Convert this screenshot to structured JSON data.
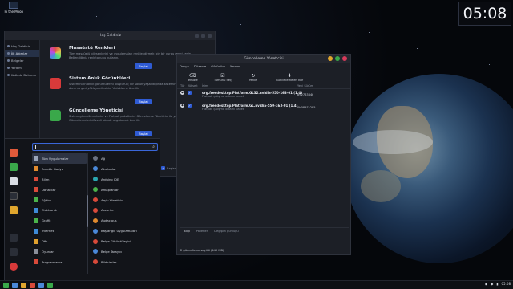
{
  "desktop": {
    "icon_label": "To the Moon"
  },
  "clock": {
    "time": "05:08"
  },
  "welcome": {
    "title": "Hoş Geldiniz",
    "sidebar": [
      {
        "label": "Hoş Geldiniz"
      },
      {
        "label": "İlk Adımlar"
      },
      {
        "label": "Belgeler"
      },
      {
        "label": "Yardım"
      },
      {
        "label": "Katkıda Bulunun"
      }
    ],
    "sections": [
      {
        "heading": "Masaüstü Renkleri",
        "text": "Tüm masaüstü bileşenlerini ve uygulamaları renklendirmek için bir vurgu rengi seçin. Beğendiğiniz renk tonunu kullanın.",
        "button": "Başlat"
      },
      {
        "heading": "Sistem Anlık Görüntüleri",
        "text": "Sisteminizin anlık görüntülerini oluşturun; bir sorun yaşandığında sisteminizi önceki bir duruma geri yükleyebilirsiniz. Yedekleme önerilir.",
        "button": "Başlat"
      },
      {
        "heading": "Güncelleme Yöneticisi",
        "text": "Sistem güncellemelerini ve Flatpak paketlerini Güncelleme Yöneticisi ile yönetin. Güncellemeleri düzenli olarak uygulamak önerilir.",
        "button": "Başlat"
      }
    ],
    "checkbox_label": "Başlan..."
  },
  "updates": {
    "title": "Güncelleme Yöneticisi",
    "menu": [
      "Dosya",
      "Düzenle",
      "Görünüm",
      "Yardım"
    ],
    "toolbar": [
      {
        "label": "Temizle",
        "icon": "clear-icon"
      },
      {
        "label": "Tümünü Seç",
        "icon": "select-all-icon"
      },
      {
        "label": "Yenile",
        "icon": "refresh-icon"
      },
      {
        "label": "Güncellemeleri Kur",
        "icon": "install-icon"
      }
    ],
    "columns": {
      "type": "Tür",
      "upgrade": "Yükselt",
      "name": "İsim",
      "new_version": "Yeni Sürüm"
    },
    "rows": [
      {
        "name": "org.freedesktop.Platform.GL32.nvidia-550-163-01 (1.4)",
        "desc": "Flatpak çalışma ortamı paketi",
        "version": "b9276364f"
      },
      {
        "name": "org.freedesktop.Platform.GL.nvidia-550-163-01 (1.4)",
        "desc": "Flatpak çalışma ortamı paketi",
        "version": "0b0897c285"
      }
    ],
    "info_tabs": [
      "Bilgi",
      "Paketler",
      "Değişim günlüğü"
    ],
    "status": "2 güncelleme seçildi (449 MB)"
  },
  "menu": {
    "search": {
      "placeholder": ""
    },
    "categories": [
      {
        "label": "Tüm Uygulamalar",
        "color": "#9aa4b8"
      },
      {
        "label": "Amatör Radyo",
        "color": "#e08a2e"
      },
      {
        "label": "Bilim",
        "color": "#d84a3a"
      },
      {
        "label": "Donatılar",
        "color": "#d84a3a"
      },
      {
        "label": "Eğitim",
        "color": "#4ab34a"
      },
      {
        "label": "Elektronik",
        "color": "#3e8ad6"
      },
      {
        "label": "Grafik",
        "color": "#4ab34a"
      },
      {
        "label": "İnternet",
        "color": "#3e8ad6"
      },
      {
        "label": "Ofis",
        "color": "#e0a02e"
      },
      {
        "label": "Oyunlar",
        "color": "#8a8f9a"
      },
      {
        "label": "Programlama",
        "color": "#d84a3a"
      },
      {
        "label": "",
        "color": "#2a2e37"
      }
    ],
    "apps": [
      {
        "label": "Ağ",
        "color": "#6a7182"
      },
      {
        "label": "Akıalonlar",
        "color": "#4a88d8"
      },
      {
        "label": "Arduino IDE",
        "color": "#2aa7b0"
      },
      {
        "label": "Arkaplanlar",
        "color": "#4ab34a"
      },
      {
        "label": "Arşiv Yöneticisi",
        "color": "#d84a3a"
      },
      {
        "label": "Aseprite",
        "color": "#d84a3a"
      },
      {
        "label": "Audacious",
        "color": "#e08a2e"
      },
      {
        "label": "Başlangıç Uygulamaları",
        "color": "#4a88d8"
      },
      {
        "label": "Belge Görüntüleyici",
        "color": "#d84a3a"
      },
      {
        "label": "Belge Tarayıcı",
        "color": "#4a88d8"
      },
      {
        "label": "Bildirimler",
        "color": "#d84a3a"
      },
      {
        "label": "",
        "color": "#2a2e37"
      }
    ]
  }
}
